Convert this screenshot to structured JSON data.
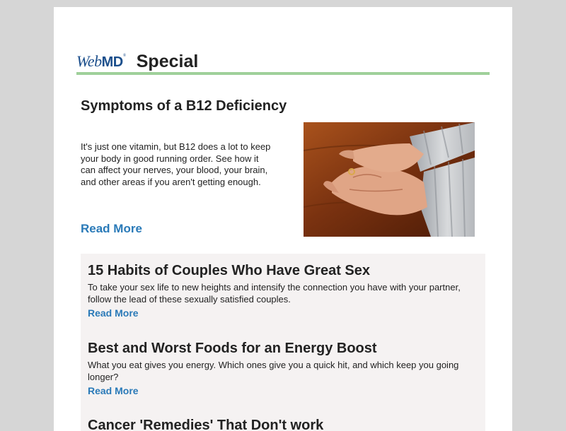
{
  "header": {
    "logo_web": "Web",
    "logo_md": "MD",
    "logo_mark": "®",
    "special": "Special"
  },
  "colors": {
    "accent_rule": "#9fd09a",
    "link": "#2a7ab8",
    "panel": "#f5f2f2"
  },
  "feature": {
    "title": "Symptoms of a B12 Deficiency",
    "text": "It's just one vitamin, but B12 does a lot to keep your body in good running order. See how it can affect your nerves, your blood, your brain, and other areas if you aren't getting enough.",
    "read_more": "Read More",
    "image_desc": "hands-on-wooden-table"
  },
  "articles": [
    {
      "title": "15 Habits of Couples Who Have Great Sex",
      "text": "To take your sex life to new heights and intensify the connection you have with your partner, follow the lead of these sexually satisfied couples.",
      "read_more": "Read More"
    },
    {
      "title": "Best and Worst Foods for an Energy Boost",
      "text": "What you eat gives you energy. Which ones give you a quick hit, and which keep you going longer?",
      "read_more": "Read More"
    },
    {
      "title": "Cancer 'Remedies' That Don't work",
      "text": "",
      "read_more": ""
    }
  ]
}
